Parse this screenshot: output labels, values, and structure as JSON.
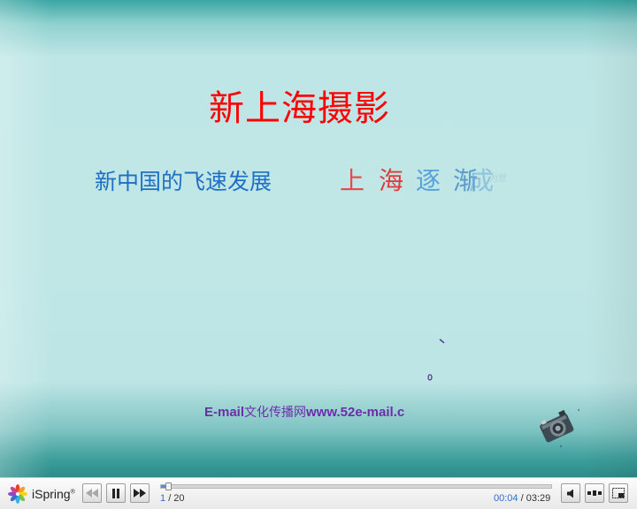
{
  "slide": {
    "title": "新上海摄影",
    "subtitle": "新中国的飞速发展",
    "animated_chars": [
      "上",
      "海",
      "逐",
      "渐",
      "成"
    ],
    "ghost_text": "为世",
    "email_prefix": "E-mail",
    "email_cn": "文化传播网",
    "email_site": "www.52e-mail.c"
  },
  "player": {
    "logo_label": "iSpring",
    "logo_mark": "®",
    "slide_current": "1",
    "slide_total": "/ 20",
    "time_current": "00:04",
    "time_total": "/ 03:29",
    "progress_fraction": 0.019,
    "accent_color": "#2a6fd0",
    "icons": [
      "rewind-icon",
      "pause-icon",
      "forward-icon",
      "volume-icon",
      "playlist-icon",
      "fullscreen-icon"
    ]
  }
}
